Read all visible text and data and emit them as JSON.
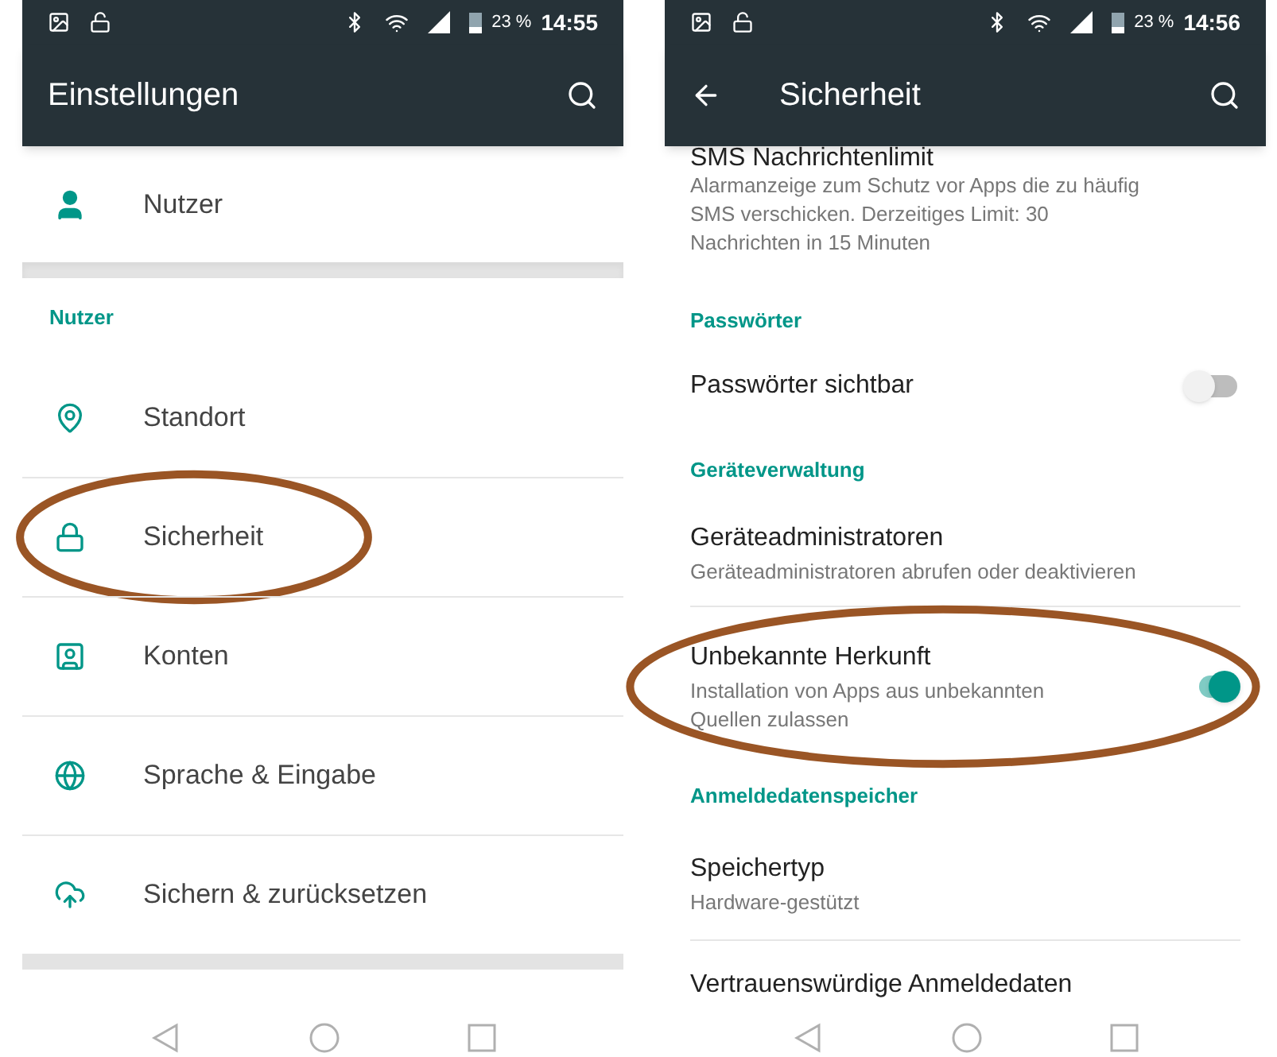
{
  "left_phone": {
    "status_bar": {
      "battery": "23 %",
      "time": "14:55"
    },
    "toolbar": {
      "title": "Einstellungen"
    },
    "top_item": {
      "label": "Nutzer"
    },
    "section": {
      "header": "Nutzer",
      "items": [
        {
          "label": "Standort",
          "highlighted": false
        },
        {
          "label": "Sicherheit",
          "highlighted": true
        },
        {
          "label": "Konten",
          "highlighted": false
        },
        {
          "label": "Sprache & Eingabe",
          "highlighted": false
        },
        {
          "label": "Sichern & zurücksetzen",
          "highlighted": false
        }
      ]
    }
  },
  "right_phone": {
    "status_bar": {
      "battery": "23 %",
      "time": "14:56"
    },
    "toolbar": {
      "title": "Sicherheit"
    },
    "items": [
      {
        "kind": "text",
        "title": "SMS Nachrichtenlimit",
        "summary": "Alarmanzeige zum Schutz vor Apps die zu häufig SMS verschicken. Derzeitiges Limit: 30 Nachrichten in 15 Minuten",
        "highlighted": false
      },
      {
        "kind": "header",
        "title": "Passwörter"
      },
      {
        "kind": "toggle",
        "title": "Passwörter sichtbar",
        "on": false,
        "highlighted": false
      },
      {
        "kind": "header",
        "title": "Geräteverwaltung"
      },
      {
        "kind": "text",
        "title": "Geräteadministratoren",
        "summary": "Geräteadministratoren abrufen oder deaktivieren",
        "highlighted": false
      },
      {
        "kind": "toggle",
        "title": "Unbekannte Herkunft",
        "summary": "Installation von Apps aus unbekannten Quellen zulassen",
        "on": true,
        "highlighted": true
      },
      {
        "kind": "header",
        "title": "Anmeldedatenspeicher"
      },
      {
        "kind": "text",
        "title": "Speichertyp",
        "summary": "Hardware-gestützt",
        "highlighted": false
      },
      {
        "kind": "text",
        "title": "Vertrauenswürdige Anmeldedaten",
        "highlighted": false
      }
    ]
  }
}
